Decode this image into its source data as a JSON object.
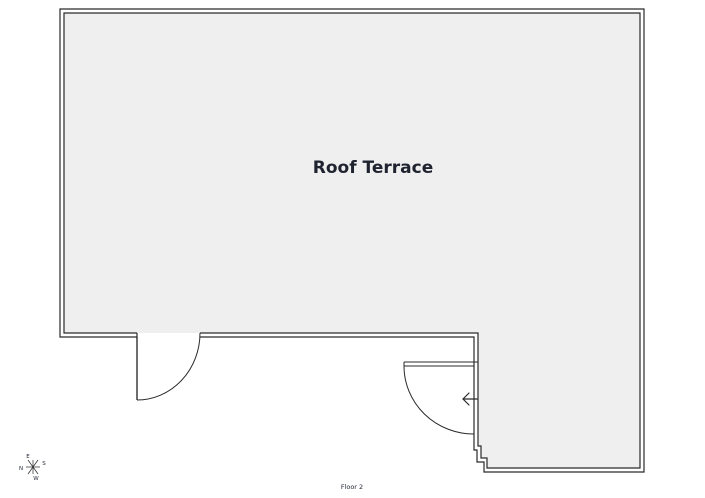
{
  "floorplan": {
    "room_name": "Roof Terrace",
    "floor_name": "Floor 2",
    "colors": {
      "room_fill": "#efefef",
      "wall": "#2a2a2a",
      "text": "#1f2330",
      "background": "#ffffff"
    },
    "compass": {
      "north": "N",
      "east": "E",
      "south": "S",
      "west": "W"
    },
    "icons": [
      "door-swing-icon",
      "entry-arrow-icon",
      "compass-icon"
    ]
  }
}
